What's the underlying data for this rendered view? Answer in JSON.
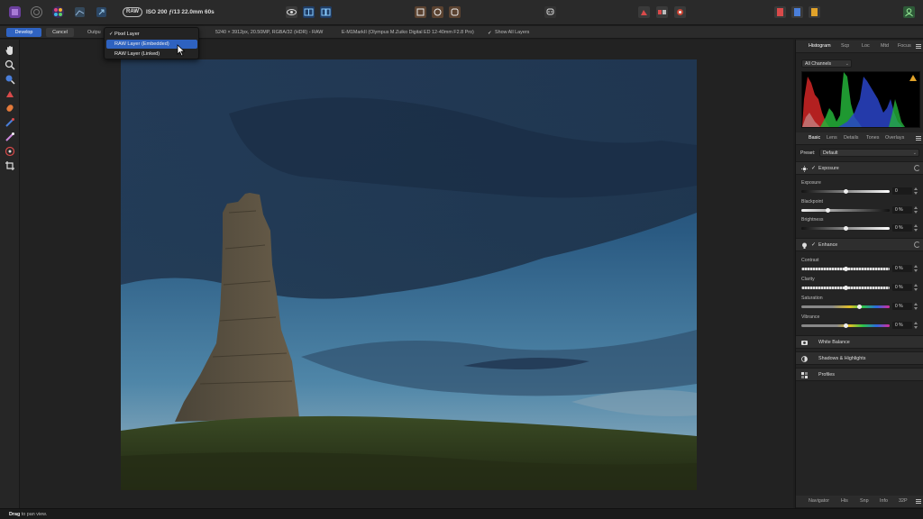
{
  "toolbar": {
    "raw_badge": "RAW",
    "shot_info": "ISO 200 ƒ/13 22.0mm 60s"
  },
  "context_bar": {
    "develop_label": "Develop",
    "cancel_label": "Cancel",
    "output_label": "Outpu",
    "image_info": "5240 × 3912px, 20.50MP, RGBA/32 (HDR) - RAW",
    "camera_info": "E-M1MarkII (Olympus M.Zuiko Digital ED 12-40mm F2.8 Pro)",
    "show_all_layers": "Show All Layers"
  },
  "output_dropdown": {
    "items": [
      {
        "label": "Pixel Layer",
        "checked": true
      },
      {
        "label": "RAW Layer (Embedded)",
        "checked": false,
        "highlighted": true
      },
      {
        "label": "RAW Layer (Linked)",
        "checked": false
      }
    ]
  },
  "right_panel": {
    "top_tabs": [
      "Histogram",
      "Scp",
      "Loc",
      "Mtd",
      "Focus"
    ],
    "channels_select": "All Channels",
    "adjust_tabs": [
      "Basic",
      "Lens",
      "Details",
      "Tones",
      "Overlays"
    ],
    "preset_label": "Preset:",
    "preset_value": "Default",
    "exposure_section": {
      "title": "Exposure",
      "sliders": [
        {
          "label": "Exposure",
          "value": "0"
        },
        {
          "label": "Blackpoint",
          "value": "0 %"
        },
        {
          "label": "Brightness",
          "value": "0 %"
        }
      ]
    },
    "enhance_section": {
      "title": "Enhance",
      "sliders": [
        {
          "label": "Contrast",
          "value": "0 %"
        },
        {
          "label": "Clarity",
          "value": "0 %"
        },
        {
          "label": "Saturation",
          "value": "0 %"
        },
        {
          "label": "Vibrance",
          "value": "0 %"
        }
      ]
    },
    "collapsed_sections": [
      "White Balance",
      "Shadows & Highlights",
      "Profiles"
    ],
    "bottom_tabs": [
      "Navigator",
      "His",
      "Snp",
      "Info",
      "32P"
    ]
  },
  "status": {
    "bold": "Drag",
    "text": " to pan view."
  },
  "colors": {
    "accent": "#2f63c2",
    "warning": "#e2a32a"
  }
}
